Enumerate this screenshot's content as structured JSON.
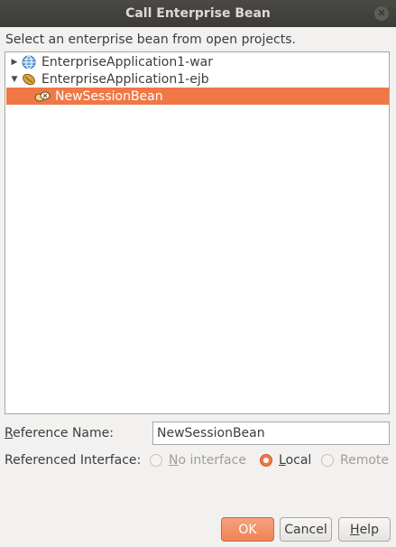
{
  "window": {
    "title": "Call Enterprise Bean",
    "close_glyph": "✕"
  },
  "instruction": "Select an enterprise bean from open projects.",
  "tree": {
    "nodes": [
      {
        "label": "EnterpriseApplication1-war",
        "toggle": "▶",
        "icon": "globe-icon",
        "expanded": false
      },
      {
        "label": "EnterpriseApplication1-ejb",
        "toggle": "▼",
        "icon": "bean-module-icon",
        "expanded": true
      },
      {
        "label": "NewSessionBean",
        "icon": "session-bean-icon",
        "selected": true
      }
    ]
  },
  "reference_name": {
    "label_underlined": "R",
    "label_rest": "eference Name:",
    "value": "NewSessionBean"
  },
  "referenced_interface": {
    "label": "Referenced Interface:",
    "options": [
      {
        "mnemonic": "N",
        "rest": "o interface",
        "checked": false,
        "enabled": false
      },
      {
        "mnemonic": "L",
        "rest": "ocal",
        "checked": true,
        "enabled": true
      },
      {
        "mnemonic": "",
        "rest": "Remote",
        "checked": false,
        "enabled": false
      }
    ]
  },
  "buttons": {
    "ok": "OK",
    "cancel": "Cancel",
    "help_mnemonic": "H",
    "help_rest": "elp"
  },
  "colors": {
    "accent": "#f07746",
    "titlebar": "#3c3b37",
    "background": "#f2f1f0"
  }
}
